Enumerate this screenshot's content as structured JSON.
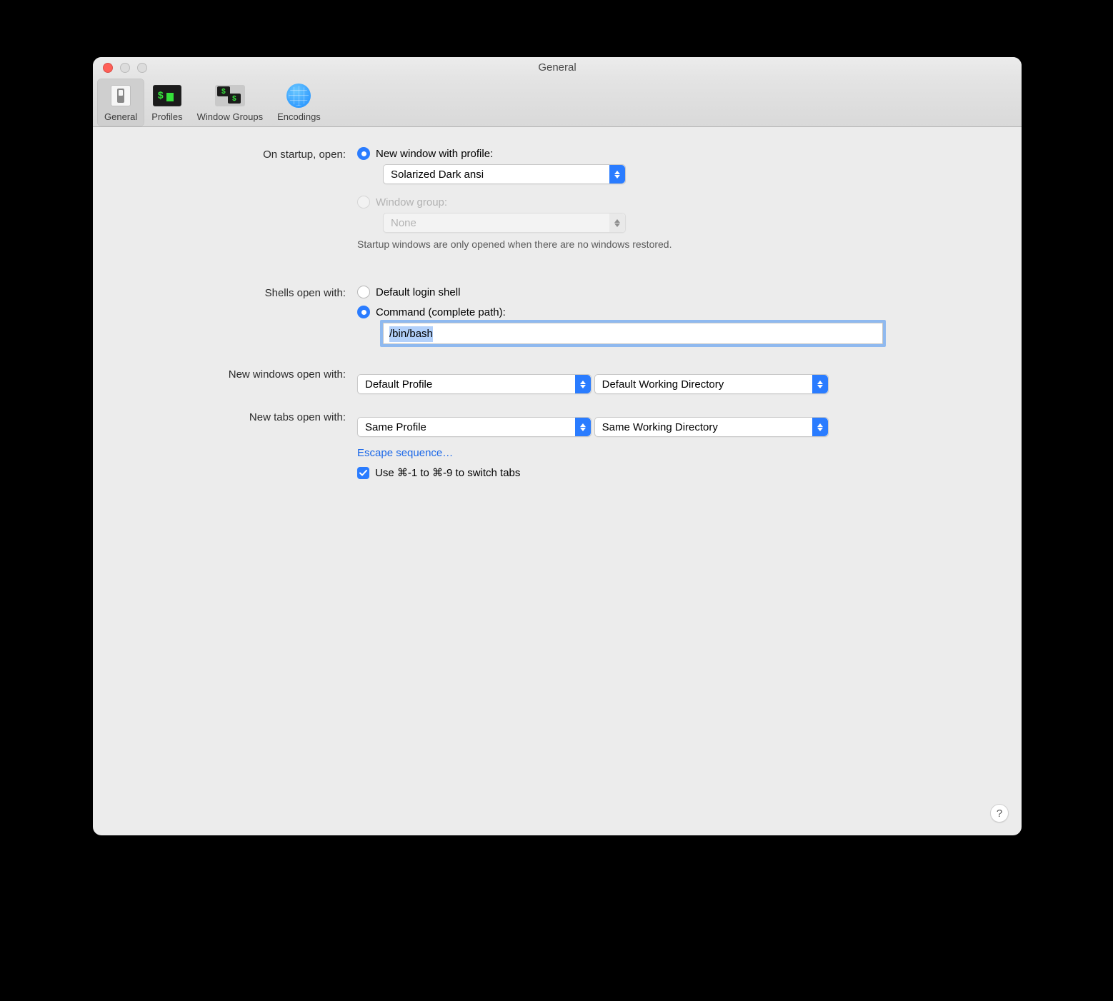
{
  "window": {
    "title": "General"
  },
  "toolbar": {
    "tabs": {
      "general": "General",
      "profiles": "Profiles",
      "window_groups": "Window Groups",
      "encodings": "Encodings"
    }
  },
  "startup": {
    "label": "On startup, open:",
    "option_new_window": "New window with profile:",
    "profile_selected": "Solarized Dark ansi",
    "option_window_group": "Window group:",
    "window_group_selected": "None",
    "hint": "Startup windows are only opened when there are no windows restored."
  },
  "shells": {
    "label": "Shells open with:",
    "option_default_login": "Default login shell",
    "option_command": "Command (complete path):",
    "command_value": "/bin/bash"
  },
  "new_windows": {
    "label": "New windows open with:",
    "profile_selected": "Default Profile",
    "dir_selected": "Default Working Directory"
  },
  "new_tabs": {
    "label": "New tabs open with:",
    "profile_selected": "Same Profile",
    "dir_selected": "Same Working Directory"
  },
  "escape_link": "Escape sequence…",
  "switch_tabs_checkbox": "Use ⌘-1 to ⌘-9 to switch tabs",
  "help_button": "?"
}
